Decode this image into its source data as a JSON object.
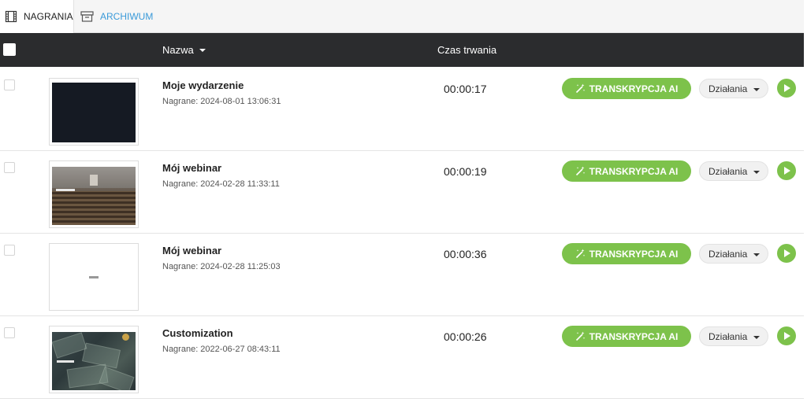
{
  "tabs": [
    {
      "label": "NAGRANIA",
      "icon": "film-strip-icon",
      "active": true
    },
    {
      "label": "ARCHIWUM",
      "icon": "archive-box-icon",
      "active": false
    }
  ],
  "table": {
    "header": {
      "name": "Nazwa",
      "duration": "Czas trwania"
    },
    "rows": [
      {
        "title": "Moje wydarzenie",
        "recorded": "Nagrane: 2024-08-01 13:06:31",
        "duration": "00:00:17",
        "thumbnail": "dark"
      },
      {
        "title": "Mój webinar",
        "recorded": "Nagrane: 2024-02-28 11:33:11",
        "duration": "00:00:19",
        "thumbnail": "lecture-hall"
      },
      {
        "title": "Mój webinar",
        "recorded": "Nagrane: 2024-02-28 11:25:03",
        "duration": "00:00:36",
        "thumbnail": "white"
      },
      {
        "title": "Customization",
        "recorded": "Nagrane: 2022-06-27 08:43:11",
        "duration": "00:00:26",
        "thumbnail": "money"
      }
    ]
  },
  "actions": {
    "transcription_label": "TRANSKRYPCJA AI",
    "actions_label": "Działania"
  },
  "colors": {
    "accent_green": "#7dc24b",
    "tab_blue": "#3a9ad9",
    "header_dark": "#2b2c2e"
  }
}
